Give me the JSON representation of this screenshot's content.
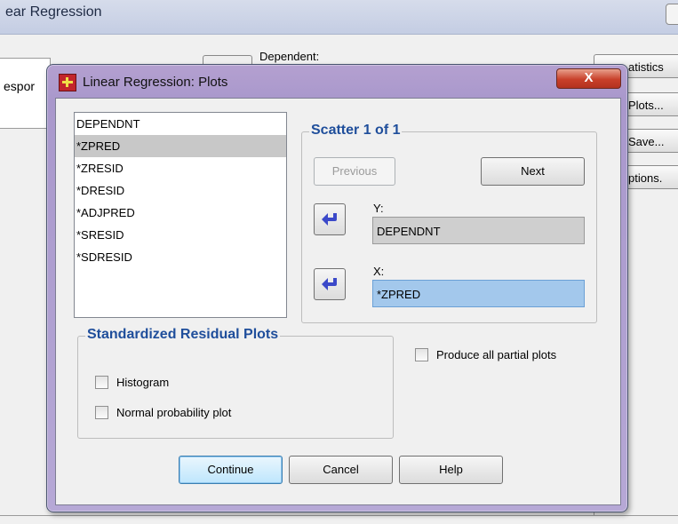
{
  "background": {
    "window_title": "ear Regression",
    "left_field_text": "espor",
    "dependent_label": "Dependent:",
    "buttons": [
      "atistics",
      "Plots...",
      "Save...",
      "ptions."
    ]
  },
  "dialog": {
    "title": "Linear Regression: Plots",
    "close_label": "X",
    "variables": [
      "DEPENDNT",
      "*ZPRED",
      "*ZRESID",
      "*DRESID",
      "*ADJPRED",
      "*SRESID",
      "*SDRESID"
    ],
    "selected_variable": "*ZPRED",
    "scatter": {
      "title": "Scatter 1 of 1",
      "previous_label": "Previous",
      "next_label": "Next",
      "y_label": "Y:",
      "y_value": "DEPENDNT",
      "x_label": "X:",
      "x_value": "*ZPRED"
    },
    "std_residual": {
      "title": "Standardized Residual Plots",
      "histogram_label": "Histogram",
      "normal_label": "Normal probability plot"
    },
    "partial_plots_label": "Produce all partial plots",
    "buttons": {
      "continue": "Continue",
      "cancel": "Cancel",
      "help": "Help"
    }
  }
}
